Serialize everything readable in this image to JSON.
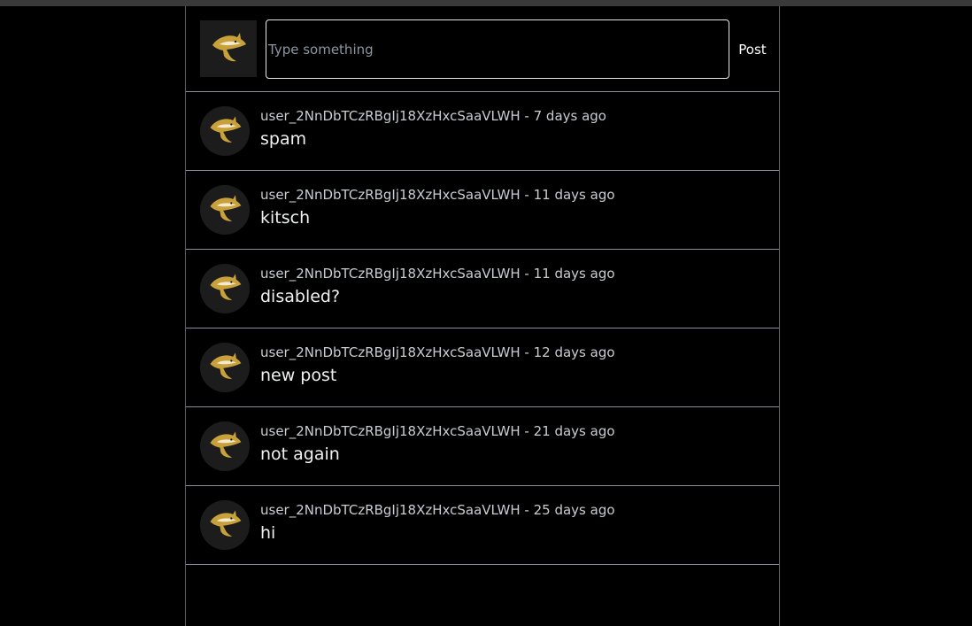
{
  "composer": {
    "placeholder": "Type something",
    "value": "",
    "post_label": "Post",
    "avatar_icon": "shark-icon"
  },
  "posts": [
    {
      "username": "user_2NnDbTCzRBgIj18XzHxcSaaVLWH",
      "separator": " - ",
      "time": "7 days ago",
      "text": "spam"
    },
    {
      "username": "user_2NnDbTCzRBgIj18XzHxcSaaVLWH",
      "separator": " - ",
      "time": "11 days ago",
      "text": "kitsch"
    },
    {
      "username": "user_2NnDbTCzRBgIj18XzHxcSaaVLWH",
      "separator": " - ",
      "time": "11 days ago",
      "text": "disabled?"
    },
    {
      "username": "user_2NnDbTCzRBgIj18XzHxcSaaVLWH",
      "separator": " - ",
      "time": "12 days ago",
      "text": "new post"
    },
    {
      "username": "user_2NnDbTCzRBgIj18XzHxcSaaVLWH",
      "separator": " - ",
      "time": "21 days ago",
      "text": "not again"
    },
    {
      "username": "user_2NnDbTCzRBgIj18XzHxcSaaVLWH",
      "separator": " - ",
      "time": "25 days ago",
      "text": "hi"
    }
  ],
  "colors": {
    "background": "#000000",
    "border": "#8b9098",
    "avatar_bg": "#1c1c1c",
    "shark_gold": "#c9a13b"
  }
}
